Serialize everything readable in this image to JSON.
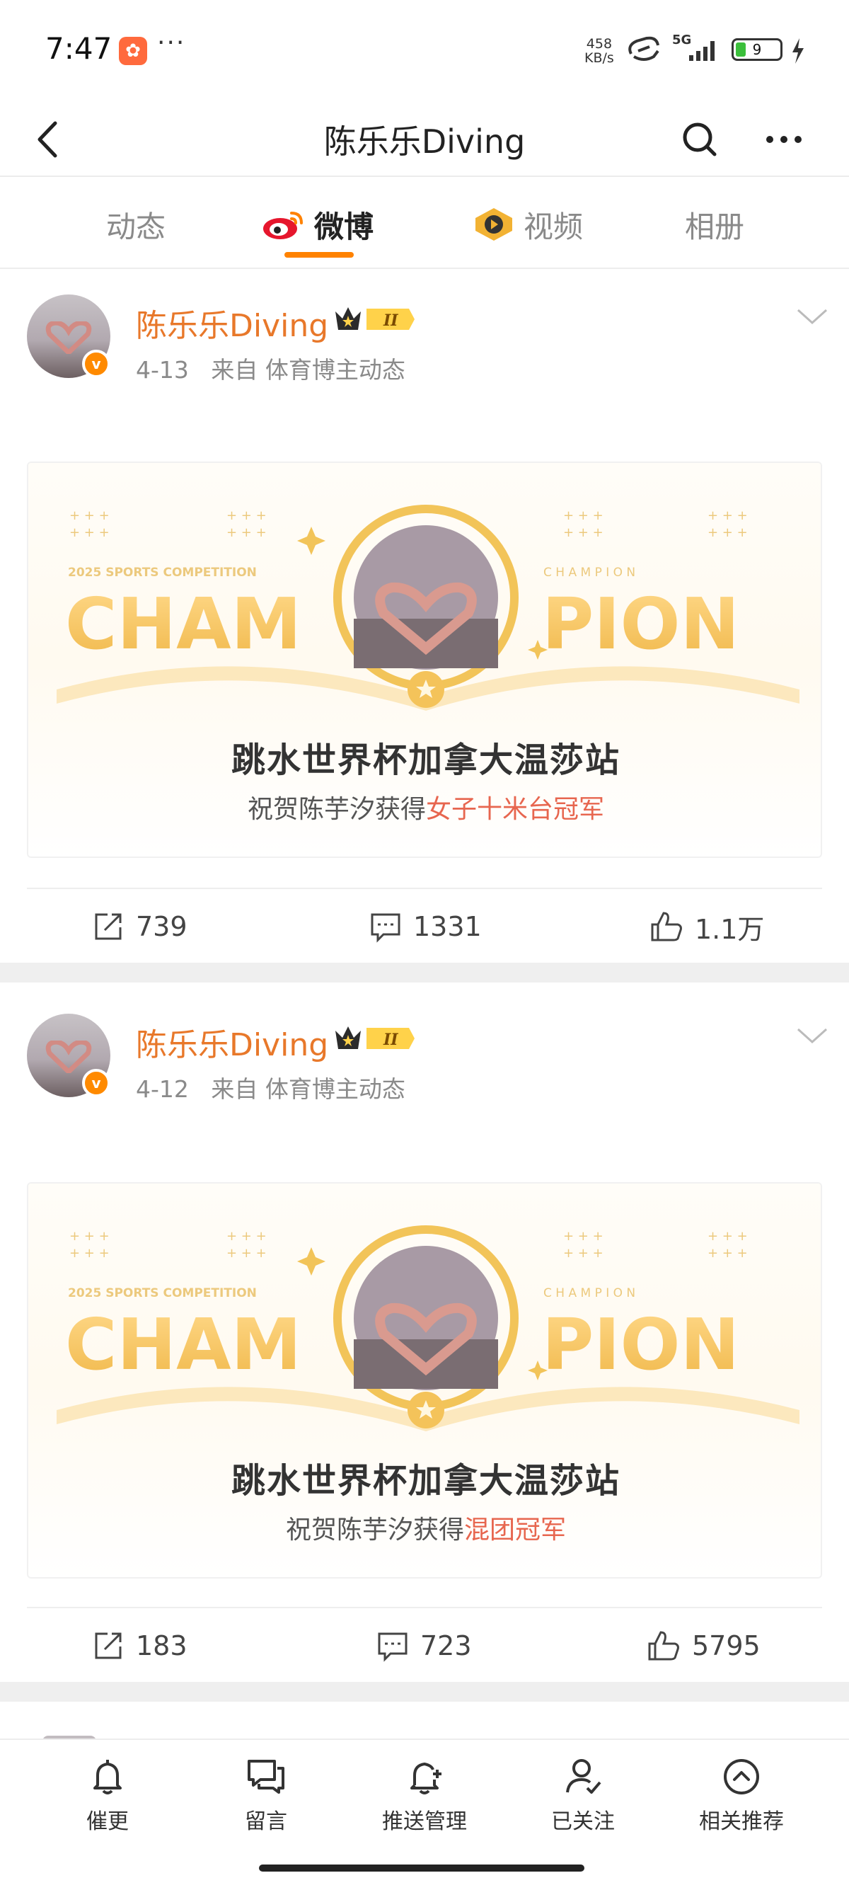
{
  "status_bar": {
    "time": "7:47",
    "app_icon_glyph": "✿",
    "dots": "···",
    "net_speed_value": "458",
    "net_speed_unit": "KB/s",
    "network": "5G",
    "battery": "9"
  },
  "nav": {
    "title": "陈乐乐Diving",
    "back_icon": "chevron-left-icon",
    "search_icon": "search-icon",
    "more_icon": "more-horizontal-icon"
  },
  "tabs": [
    {
      "label": "动态",
      "active": false
    },
    {
      "label": "微博",
      "active": true,
      "icon": "weibo-logo-icon"
    },
    {
      "label": "视频",
      "active": false,
      "icon": "video-play-icon"
    },
    {
      "label": "相册",
      "active": false
    }
  ],
  "colors": {
    "accent": "#ff8200",
    "author": "#e8782a",
    "highlight": "#e7664f",
    "gold": "#f4c35a"
  },
  "posts": [
    {
      "author": "陈乐乐Diving",
      "badge_level": "II",
      "date": "4-13",
      "source": "来自 体育博主动态",
      "card": {
        "banner_small_left": "2025 SPORTS COMPETITION",
        "banner_small_right": "C H A M P I O N",
        "banner_left": "CHAM",
        "banner_right": "PION",
        "title": "跳水世界杯加拿大温莎站",
        "subtitle_prefix": "祝贺陈芋汐获得",
        "subtitle_highlight": "女子十米台冠军"
      },
      "reposts": "739",
      "comments": "1331",
      "likes": "1.1万"
    },
    {
      "author": "陈乐乐Diving",
      "badge_level": "II",
      "date": "4-12",
      "source": "来自 体育博主动态",
      "card": {
        "banner_small_left": "2025 SPORTS COMPETITION",
        "banner_small_right": "C H A M P I O N",
        "banner_left": "CHAM",
        "banner_right": "PION",
        "title": "跳水世界杯加拿大温莎站",
        "subtitle_prefix": "祝贺陈芋汐获得",
        "subtitle_highlight": "混团冠军"
      },
      "reposts": "183",
      "comments": "723",
      "likes": "5795"
    }
  ],
  "bottom_bar": [
    {
      "label": "催更",
      "icon": "bell-icon"
    },
    {
      "label": "留言",
      "icon": "message-icon"
    },
    {
      "label": "推送管理",
      "icon": "bell-plus-icon"
    },
    {
      "label": "已关注",
      "icon": "user-check-icon"
    },
    {
      "label": "相关推荐",
      "icon": "chevron-up-circle-icon"
    }
  ]
}
